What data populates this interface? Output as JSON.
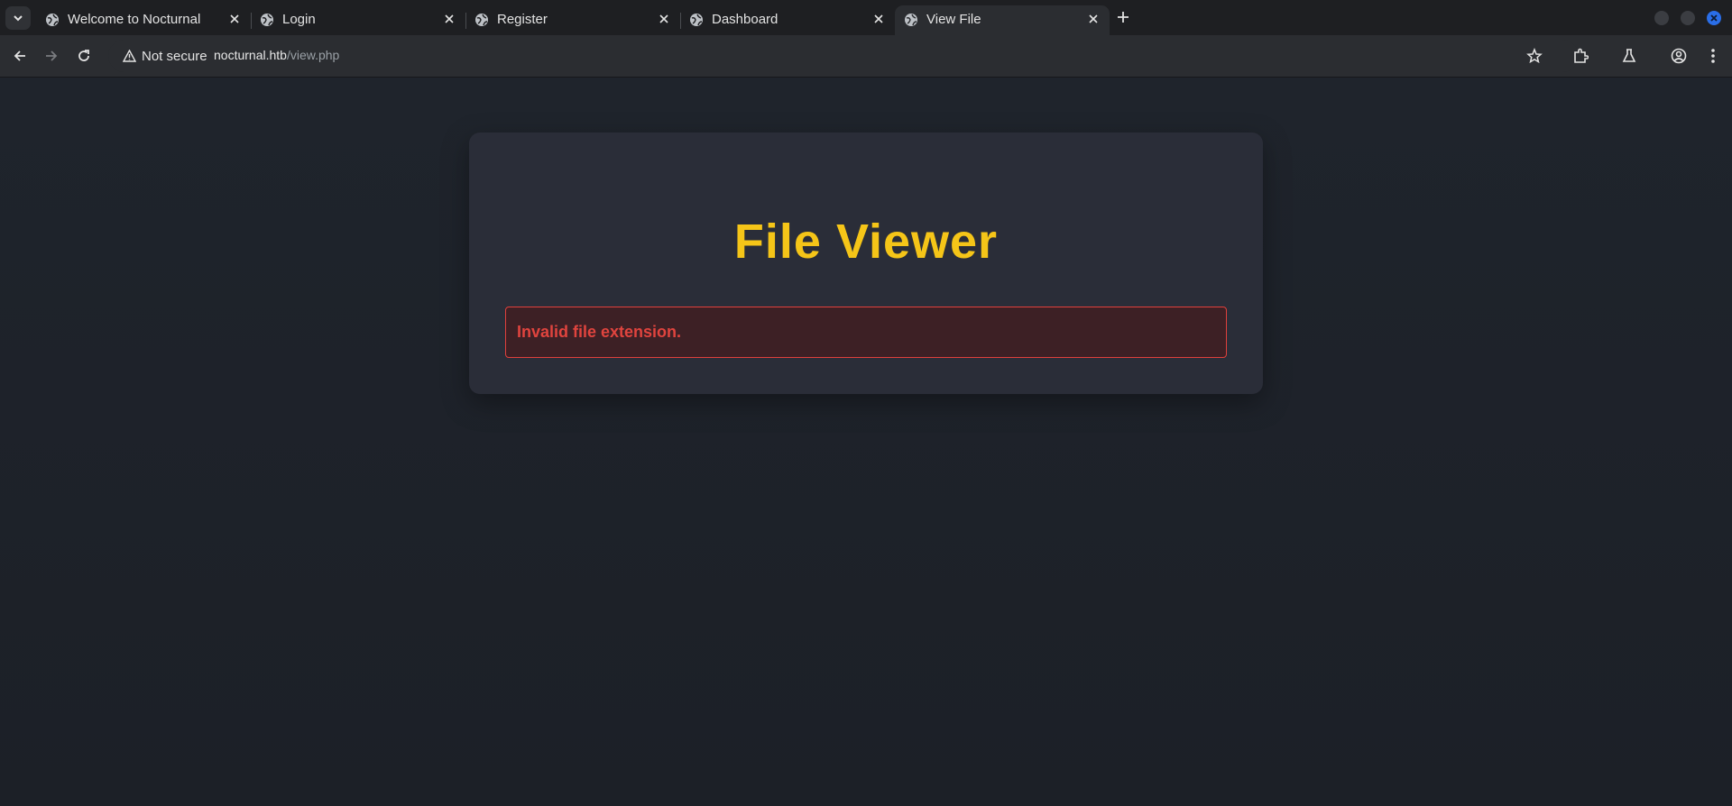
{
  "browser": {
    "tabs": [
      {
        "title": "Welcome to Nocturnal",
        "active": false
      },
      {
        "title": "Login",
        "active": false
      },
      {
        "title": "Register",
        "active": false
      },
      {
        "title": "Dashboard",
        "active": false
      },
      {
        "title": "View File",
        "active": true
      }
    ],
    "security_label": "Not secure",
    "url_host": "nocturnal.htb",
    "url_path": "/view.php",
    "accent_color": "#2a6ee8"
  },
  "page": {
    "title": "File Viewer",
    "error_message": "Invalid file extension.",
    "title_color": "#f5c518",
    "error_color": "#e0443e"
  }
}
